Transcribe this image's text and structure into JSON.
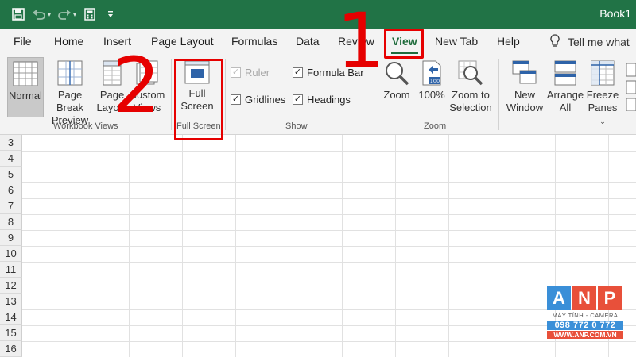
{
  "titlebar": {
    "doc_title": "Book1",
    "qat": [
      {
        "icon": "save-icon"
      },
      {
        "icon": "undo-icon"
      },
      {
        "icon": "redo-icon"
      },
      {
        "icon": "form-icon"
      },
      {
        "icon": "customize-qat-icon"
      }
    ]
  },
  "tabs": {
    "items": [
      "File",
      "Home",
      "Insert",
      "Page Layout",
      "Formulas",
      "Data",
      "Review",
      "View",
      "New Tab",
      "Help"
    ],
    "active": "View",
    "tell_me": "Tell me what"
  },
  "ribbon": {
    "workbook_views": {
      "label": "Workbook Views",
      "normal": "Normal",
      "page_break_1": "Page Break",
      "page_break_2": "Preview",
      "page_layout_1": "Page",
      "page_layout_2": "Layout",
      "custom_views_1": "Custom",
      "custom_views_2": "Views"
    },
    "full_screen": {
      "label": "Full Screen",
      "btn_1": "Full",
      "btn_2": "Screen"
    },
    "show": {
      "label": "Show",
      "ruler": "Ruler",
      "formula_bar": "Formula Bar",
      "gridlines": "Gridlines",
      "headings": "Headings"
    },
    "zoom": {
      "label": "Zoom",
      "zoom": "Zoom",
      "hundred": "100%",
      "hundred_badge": "100",
      "zoom_sel_1": "Zoom to",
      "zoom_sel_2": "Selection"
    },
    "window": {
      "new_window_1": "New",
      "new_window_2": "Window",
      "arrange_1": "Arrange",
      "arrange_2": "All",
      "freeze_1": "Freeze",
      "freeze_2": "Panes"
    }
  },
  "grid": {
    "rows": [
      "3",
      "4",
      "5",
      "6",
      "7",
      "8",
      "9",
      "10",
      "11",
      "12",
      "13",
      "14",
      "15",
      "16"
    ]
  },
  "annotations": {
    "step1": "1",
    "step2": "2"
  },
  "watermark": {
    "letters": [
      "A",
      "N",
      "P"
    ],
    "letter_colors": [
      "#3a8fd8",
      "#e8503a",
      "#e8503a"
    ],
    "subtitle": "MÁY TÍNH - CAMERA",
    "phone": "098 772 0 772",
    "url": "WWW.ANP.COM.VN"
  },
  "colors": {
    "brand": "#217346",
    "annotation": "#e60000"
  }
}
